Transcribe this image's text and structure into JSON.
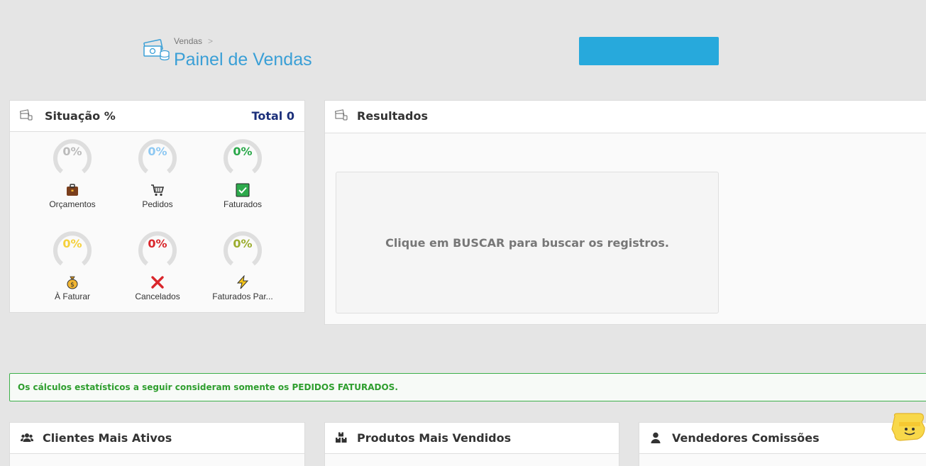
{
  "header": {
    "breadcrumb": "Vendas",
    "breadcrumb_sep": ">",
    "title": "Painel de Vendas",
    "action_button_label": ""
  },
  "situacao": {
    "title": "Situação %",
    "total": "Total 0",
    "gauges": [
      {
        "value": "0%",
        "label": "Orçamentos",
        "icon": "briefcase-icon",
        "color": "#bbbbbb"
      },
      {
        "value": "0%",
        "label": "Pedidos",
        "icon": "cart-icon",
        "color": "#8ec8f2"
      },
      {
        "value": "0%",
        "label": "Faturados",
        "icon": "check-icon",
        "color": "#2aa84a"
      },
      {
        "value": "0%",
        "label": "À Faturar",
        "icon": "money-bag-icon",
        "color": "#f5d03b"
      },
      {
        "value": "0%",
        "label": "Cancelados",
        "icon": "cross-icon",
        "color": "#d9262b"
      },
      {
        "value": "0%",
        "label": "Faturados Par...",
        "icon": "lightning-icon",
        "color": "#9cad2e"
      }
    ]
  },
  "resultados": {
    "title": "Resultados",
    "message": "Clique em BUSCAR para buscar os registros."
  },
  "notice": "Os cálculos estatísticos a seguir consideram somente os PEDIDOS FATURADOS.",
  "bottom_panels": {
    "clientes": "Clientes Mais Ativos",
    "produtos": "Produtos Mais Vendidos",
    "vendedores": "Vendedores Comissões"
  },
  "colors": {
    "accent": "#27a9dc",
    "title_blue": "#3a9fd6",
    "total_navy": "#1b2f7a",
    "notice_green": "#2e9e2e"
  }
}
